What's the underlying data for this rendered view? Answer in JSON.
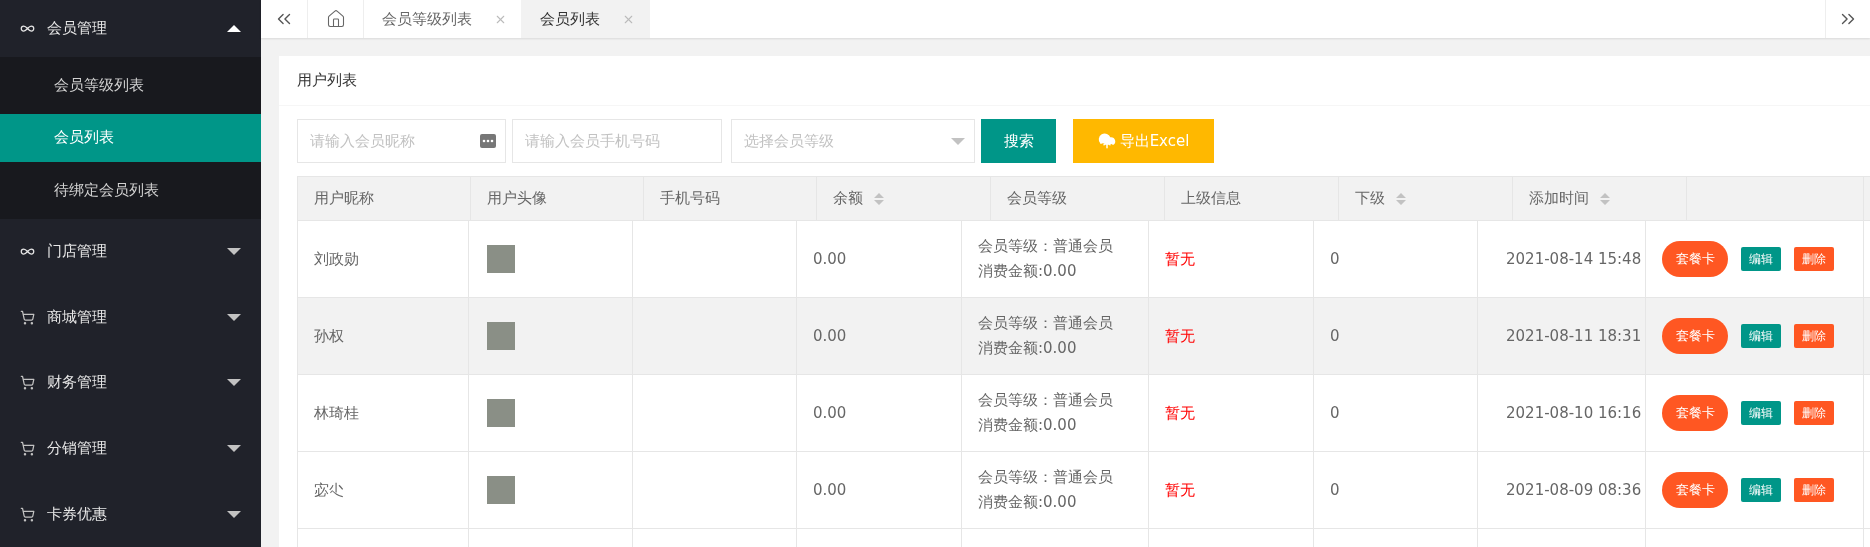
{
  "sidebar": {
    "groups": [
      {
        "label": "会员管理",
        "kind": "link",
        "expanded": true,
        "children": [
          {
            "label": "会员等级列表",
            "selected": false
          },
          {
            "label": "会员列表",
            "selected": true
          },
          {
            "label": "待绑定会员列表",
            "selected": false
          }
        ]
      },
      {
        "label": "门店管理",
        "kind": "link",
        "expanded": false
      },
      {
        "label": "商城管理",
        "kind": "cart",
        "expanded": false
      },
      {
        "label": "财务管理",
        "kind": "cart",
        "expanded": false
      },
      {
        "label": "分销管理",
        "kind": "cart",
        "expanded": false
      },
      {
        "label": "卡券优惠",
        "kind": "cart",
        "expanded": false
      }
    ]
  },
  "tabs": [
    {
      "kind": "home",
      "selected": false
    },
    {
      "kind": "page",
      "label": "会员等级列表",
      "selected": false
    },
    {
      "kind": "page",
      "label": "会员列表",
      "selected": true
    }
  ],
  "card": {
    "title": "用户列表",
    "filters": {
      "nickname": {
        "placeholder": "请输入会员昵称"
      },
      "phone": {
        "placeholder": "请输入会员手机号码"
      },
      "level": {
        "placeholder": "选择会员等级"
      },
      "search_button": "搜索",
      "export_button": "导出Excel"
    },
    "table": {
      "columns": [
        {
          "label": "用户昵称",
          "sortable": false
        },
        {
          "label": "用户头像",
          "sortable": false
        },
        {
          "label": "手机号码",
          "sortable": false
        },
        {
          "label": "余额",
          "sortable": true
        },
        {
          "label": "会员等级",
          "sortable": false
        },
        {
          "label": "上级信息",
          "sortable": false
        },
        {
          "label": "下级",
          "sortable": true
        },
        {
          "label": "添加时间",
          "sortable": true
        },
        {
          "sortable": false
        }
      ],
      "rows": [
        {
          "nickname": "刘政勋",
          "balance": "0.00",
          "level": "会员等级：普通会员",
          "spend": "消费金额:0.00",
          "parent": "暂无",
          "children": "0",
          "added": "2021-08-14 15:48",
          "hovered": false,
          "actions": [
            {
              "kind": "pill",
              "label": "套餐卡"
            },
            {
              "kind": "normal",
              "label": "编辑"
            },
            {
              "kind": "danger",
              "label": "删除"
            }
          ]
        },
        {
          "nickname": "孙权",
          "balance": "0.00",
          "level": "会员等级：普通会员",
          "spend": "消费金额:0.00",
          "parent": "暂无",
          "children": "0",
          "added": "2021-08-11 18:31",
          "hovered": true,
          "actions": [
            {
              "kind": "pill",
              "label": "套餐卡"
            },
            {
              "kind": "normal",
              "label": "编辑"
            },
            {
              "kind": "danger",
              "label": "删除"
            }
          ]
        },
        {
          "nickname": "林琦桂",
          "balance": "0.00",
          "level": "会员等级：普通会员",
          "spend": "消费金额:0.00",
          "parent": "暂无",
          "children": "0",
          "added": "2021-08-10 16:16",
          "hovered": false,
          "actions": [
            {
              "kind": "pill",
              "label": "套餐卡"
            },
            {
              "kind": "normal",
              "label": "编辑"
            },
            {
              "kind": "danger",
              "label": "删除"
            }
          ]
        },
        {
          "nickname": "宓尐",
          "balance": "0.00",
          "level": "会员等级：普通会员",
          "spend": "消费金额:0.00",
          "parent": "暂无",
          "children": "0",
          "added": "2021-08-09 08:36",
          "hovered": false,
          "actions": [
            {
              "kind": "pill",
              "label": "套餐卡"
            },
            {
              "kind": "normal",
              "label": "编辑"
            },
            {
              "kind": "danger",
              "label": "删除"
            }
          ]
        }
      ]
    }
  }
}
